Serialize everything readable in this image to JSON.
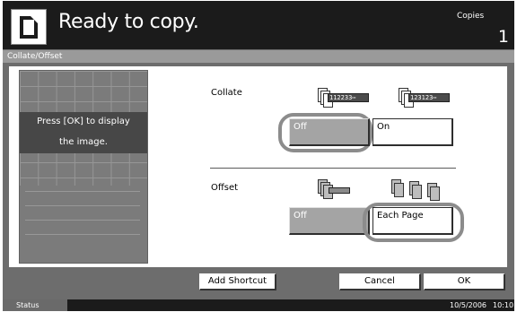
{
  "header": {
    "title": "Ready to copy.",
    "copies_label": "Copies",
    "copies_count": "1"
  },
  "screen_title": "Collate/Offset",
  "preview": {
    "message_line1": "Press [OK] to display",
    "message_line2": "the image."
  },
  "collate": {
    "label": "Collate",
    "off_label": "Off",
    "on_label": "On",
    "selected": "Off",
    "icon_off_text": "112233⋯",
    "icon_on_text": "123123⋯"
  },
  "offset": {
    "label": "Offset",
    "off_label": "Off",
    "each_page_label": "Each Page",
    "selected": "Each Page"
  },
  "buttons": {
    "add_shortcut": "Add Shortcut",
    "cancel": "Cancel",
    "ok": "OK"
  },
  "status_bar": {
    "status_label": "Status",
    "date": "10/5/2006",
    "time": "10:10"
  },
  "colors": {
    "header_bg": "#1b1b1b",
    "panel_bg": "#6d6d6d",
    "selected_button_bg": "#ffffff",
    "unselected_button_bg": "#a4a4a4",
    "highlight_ring": "#8c8c8c"
  }
}
